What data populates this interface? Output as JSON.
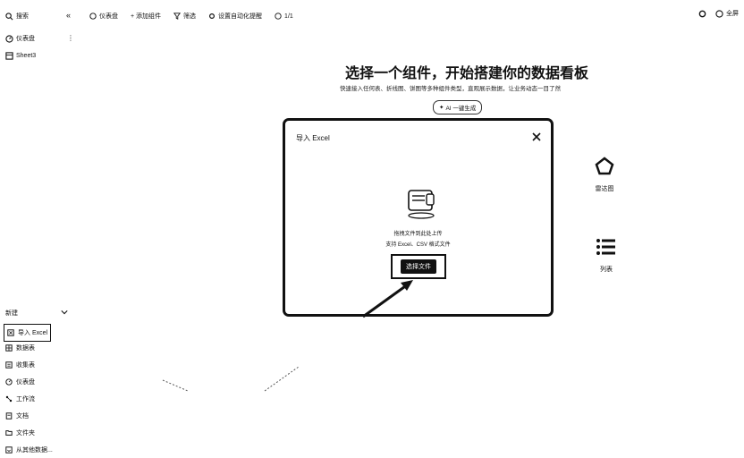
{
  "sidebar": {
    "search_label": "搜索",
    "collapse_icon": "«",
    "items": [
      {
        "label": "仪表盘",
        "icon": "dashboard-icon"
      },
      {
        "label": "Sheet3",
        "icon": "sheet-icon"
      }
    ],
    "more_label": "⋮",
    "new_section": {
      "header": "新建",
      "items": [
        {
          "label": "导入 Excel",
          "icon": "excel-icon",
          "active": true
        },
        {
          "label": "数据表",
          "icon": "table-icon"
        },
        {
          "label": "收集表",
          "icon": "form-icon"
        },
        {
          "label": "仪表盘",
          "icon": "dashboard-icon"
        },
        {
          "label": "工作流",
          "icon": "workflow-icon"
        },
        {
          "label": "文档",
          "icon": "doc-icon"
        },
        {
          "label": "文件夹",
          "icon": "folder-icon"
        },
        {
          "label": "从其他数据...",
          "icon": "import-icon"
        }
      ]
    }
  },
  "toolbar": {
    "items": [
      "仪表盘",
      "+ 添加组件",
      "筛选",
      "设置自动化提醒",
      "1/1"
    ]
  },
  "top_right": {
    "fullscreen_label": "全屏"
  },
  "hero": {
    "title": "选择一个组件，开始搭建你的数据看板",
    "subtitle": "快速接入任何表、折线图、饼图等多种组件类型，直观展示数据，让业务动态一目了然",
    "ai_button": "AI 一键生成"
  },
  "components": [
    {
      "label": "雷达图",
      "icon": "pentagon-icon"
    },
    {
      "label": "列表",
      "icon": "list-icon"
    }
  ],
  "modal": {
    "title": "导入 Excel",
    "upload_hint": "拖拽文件到此处上传",
    "format_hint": "支持 Excel、CSV 格式文件",
    "choose_button": "选择文件"
  }
}
